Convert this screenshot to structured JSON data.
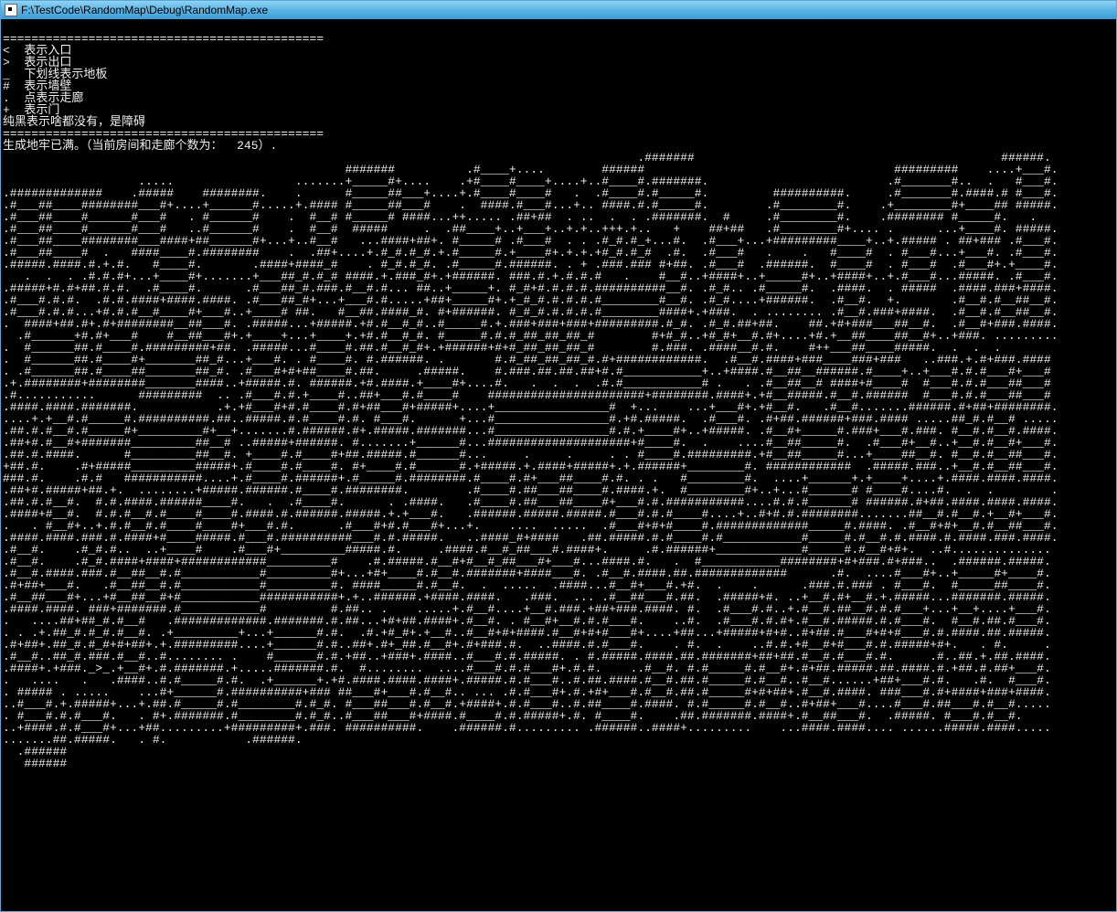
{
  "window": {
    "title": "F:\\TestCode\\RandomMap\\Debug\\RandomMap.exe"
  },
  "legend": {
    "divider": "=============================================",
    "items": [
      "<  表示入口",
      ">  表示出口",
      "_  下划线表示地板",
      "#  表示墙壁",
      ".  点表示走廊",
      "+  表示门"
    ],
    "obstacle_note": "纯黑表示啥都没有，是障碍"
  },
  "status": {
    "line": "生成地牢已满。（当前房间和走廊个数为：  245）.",
    "room_corridor_count": 245
  },
  "map_legend_symbols": {
    "entrance": "<",
    "exit": ">",
    "floor": "_",
    "wall": "#",
    "corridor": ".",
    "door": "+"
  },
  "map_lines": [
    "                                                                                         .#######                                           ######.",
    "                                                #######          .#____+....        ######                                   #########    ....+___#.",
    "                   .....                 .......+_____#+....    .+#____#____+....+..#____#.#######.                         .#_______#..  .   #___#.",
    ".#############    .#####    ########.    .      #_____##___+....+.#____#____#   .  .#____#.#_____#.         ##########.     .#_______#.####.# #___#.",
    ".#___##____########___#+....+______#.....+.#### #_____##___#    .  ####.#___#...+.. ####.#.#_____#.        .#________#.    .+________#+____## #####.",
    ".#___##____#______#___#   . #______#    .  #__# #_____# ####...++..... .##+##  . ..  .  . .#######.  #     .#________#.    .######## #_____#.   .   ",
    ".#___##____#______#___#   ..#______#    .  #__#  #####     .  .##____+..+___+..+.+..+++.+..   +    ##+##   .#________#+.... .      ...+____#. #####.",
    ".#___##____########___####+##______#+...+..#__#   ...####+##+. #_____# .#___#  . . .#_#.#_+...#.  .#___+...+#########____+..+.##### . ##+### .#___#.",
    ".#___##____#  .   ####____#.########    .  .##+....+.#_#.#_#.+.#_____#.+____#+.+.+.+#_#.#_#  .#.  .#___#   .    .   #____#  . #___#...+___#. .#___#.",
    ".#####.####.#.+.#.   #____#.       .####+####_#    . #_#.#_#. .#_____#.######. . + .###.### #+##. .#___#  .######.  #____#  . #___#  .#___#+.+____#.",
    "   .  .  . .#.#.#+...+____#+.......+___##_#.#_# ####.+.###_#+.+######. ###.#.+.#.#.#   .    #__#..+####+..+_____#+..+####+..+.#___#...#####. .#___#.",
    ".#####+#.#+##.#.#.  .#____#.      .#___##_#.###.#__#.#... ##..+_____+. #_#+#.#.#.#.##########__#. .#_#.. .#_____#.  .####.  . #####  .####.###+####.",
    ".#___#.#.#.  .#.#.####+####.####. .#___##_#+...+___#.#.....+##+_____#+.+_#_#.#.#.#.#________#__#. .#_#....+######.  .#__#.  +.       .#__#.#__##__#.",
    ".#___#.#.#...+#.#.#__#____#+___#..+____# ##.   #__##.####_#. #+######. #_#_#.#.#.#.#________####+.+###.  . ........ .#__#.###+####.  .#__#.#__##__#.",
    ".  ####+##.#+.#+########__##___#. .#####...+#####.+#.#__#_#..#_____#.+.###+###+###+#########.#_#. .#_#.##+##.    ##.+#+###___##__#.  .#__#+###.####.",
    "  .#______+#.#+___#    #__##___#+.+____+...+____+.+#.#__#_#. #_____#.#.#_##_##_##_#        #+#_#..+#_#+__#.#+....+#.+__##____##__#+..+###. .........",
    ".  #______##.#____#.#########+##. .#####...#____#.##.#__#_#+.+######+#+#_##_##_##_#        #.###. .####__#.#.    #++___##____#####.  .  .  .        ",
    ".  #______##.#____#+_______##_#...+___#. . #____#. #.######. .       #.#_##_##_##_#.#+############.  .#__#.####+###____###+###   ..###.+.#+###.#### ",
    ". .#______##.#____##_______##_#. .#___#+#+##____#.##.     .#####.    #.###.##.##.##+#.#___________+..+####.#__##__######.#____+..+___#.#.#___#+___# ",
    ".+.########+########_______####..+#####.#. ######.+#.####.+____#+....#.   .  .  .  .#.#___________# .   . .#__##__# ####+#____#  #___#.#.#___##___# ",
    ".#...........      #########  .. .#___#.#.+____#..##+___#.#____#    ######################+########.####+.+#__#####.#__#.######  #___#.#.#___##___# ",
    ".####.####.#######.           .+.+#___#+#.#____#.#+##___#+#####+....+________________#  +...    ...+___#+.+#__#.   .#__#.......######.#+##+########.",
    "....+.+__#.#_____#.##########.##..#####.#.#____#.#. #___#.      +...#________________#.+#.#####.  .#___#. .#+##.######+###.#### .....##_#.#__# .....",
    ".##.#.#__#.#_____#+_________#+__+.......#.######.#+.#####.#######...#________________#.#.+____#+..+#####. .#__#+_____#.###+___#.###. #__#.#__#.####.",
    ".##+#.#__#+#######_________##__# ..#####+######. #.......+______#...####################+#____#.  .    ....#__##_____#.  .#___#+__#..+__#.#__#+___#.",
    ".##.#.####.      #_________##__#. +____#.#____#+##.#####.#______#...     .     .     . . #____#.#########.+#__##_____#...+____##__#. #__#.#__##___#.",
    "+##.#.    .#+#####_________#####+.#____#.#____#. #+____#.#______#.+#####.+.####+#####+.+.######+________#. ############  .#####.###..+__#.#__##___#.",
    "###.#.    .#.#   ###########....+.#____#.######+.#_____#.########.#____#.#+___##____#.#. . .   #________#.  ....+______+.+____+....+.####.####.####.",
    ".##+#.#####+##.+.  ........+#####.######.#____#.########.        .#____#.##___##____#.####.+.  #________#+..+...#______# #____#....#.  .  .        .",
    ".##.#.#__#.  #.#.####.######____#.   .  .#____#.      . .####.   .#____#.##___##____#+___#.#.###########....#.#.#______# ######.#+##.####.####.####.",
    ".####+#__#.  #.#.#__#.#____#____#.####.#.######.#####.+.+___#.   .######.#####.#####.#___#.#.#____#....+..#+#.#.########.......##__#.#__#.+__#+___#.",
    ".   . #__#+..+.#.#__#.#____#____#+___#.#.      .#___#+#.#___#+...+.    ....  .....  .#___#+#+#____#.#############_____#.####. .#__#+#+__#.#__##___#.",
    ".####.####.###.#.####+#____#####.#___#.##########___#.#.#####.   ..####_#+####   .##.#####.#.#____#.#___________#_____#.#__#.#.####.#.####.###.####.",
    ".#__#.    .#_#.#..  ..+____#    .#___#+_________#####.#.     .####.#__#_##___#.####+.     .#.######+____________#_____#.#__#+#+.  ..#.............. ",
    ".#__#.    .#_#.####+####+############_________#    .#.#####.#__#+#__#_##___#+___#...####.#.   .  #___________########+#+###.#+###..  .######.#####.",
    ".#__#.####.###.#__##__#.#___________#_________#+...+#+____#.#__#.#######+####___#. .#__#.####.##.#############      .#.  ....#___#+..+_____#+____#.",
    ".#+##+___#.   .#__##__#.#___________#_________#. ####_____#.#__#.  .  .....  .####...#__#+___#.+#.  .    .      .###.#.### . #___#.  #_____##____#.",
    ".#__##___#+...+#__##__#+#___________###########+.+..######.+####.####.   .###.  ... .#__##___#.##.  .#####+#. ..+__#.#+__#.+.#####...#######.#####.",
    ".####.####. ###+#######.#___________#         #.##.. .    .....+.#__#....+__#.###.+##+###.####. #.  .#___#.#..+.#__#.##__#.#.#___+...+__+....+___#.",
    ".   ....##+##_#.#__#   .#############.#######.#.##...+#+##.####+.#__#. . #__#+__#.#.#___#.    ..#.  .#___#.#.#+.#__#.#####.#.#___#.  #__#.##.#___#.",
    ". . .+.##_#.#_#.#__#. .+_________+...+______#.#.  .#.+#_#+.+__#..#__#+#+####.#__#+#+#___#+....+##...+#####+#+#..#+##.#___#+#+#___#.#.####.##.#####.",
    ".#+##+.##_#.#_#+#+##+.+.#########....+______#.#..##+.#+_##.#__#+.#+###.#.  ..####.#.#___#.    . #.  .    ..#.#.+#__#+#___#.#.#####+#+.   . #.     .",
    ".#__#..##_#.###.#__#..#........ .    #______#.#.+##..+###+.####..#___#.#.#####. . #.#####.####.##.#######+##+##.#__#.#___#.#.     .#..##.+.##.####.",
    ".####+.+###._>_.+__#+.#.#######.+.....#######.#.  #........  ....#___#.#.#___#+.#.#.    ..#__#. #.#_____#.#__#+.#+##.#####.##.####.#.+##.#.##+___#.",
    ".   ....   .   .####..#.#_____#.#.  .+______+.+#.####.####.####+.#####.#.#___#..#.##.####.#__#.##.#_____#.#__#..#__#......+##+___#.#.   .#.  #___#.",
    ". ##### . .....    ...#+______#.##########+### ##___#+___#.#__#.. ... .#.#___#+.#.+#+___#.#__#.##.#_____#+#+##+.#__#.####. ###___#.#+####+###+####.",
    "..#___#.+.#####+...+.##.#_____#.#________#.#_#. #___##___#.#__#.+####+.#.#___#..#.##____#.####. #.#_____#.#__#..#+##+___#....#___#.##___#.#__#.....",
    ". #___#.#.#___#.   . #+.#######.#________#.#_#..#___##___#+####.#____#.#.#####+.#. #____#.    .##.#######.####+.#__##___#.  .#####. #___#.#__#.    ",
    "..+####.#.#___#+...+##.........+#########+.###. ##########.    .######.#......... .######..####+.........    ...####.####.... ......#####.####.....",
    ".......##.#####.   . #.           .######.                                                                                                          ",
    "  .######                                                                                                                                           ",
    "   ######                                                                                                                                           "
  ]
}
